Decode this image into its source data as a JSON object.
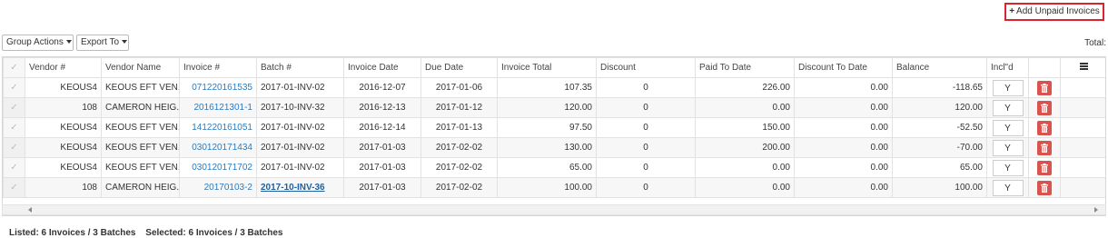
{
  "toolbar": {
    "add_unpaid_label": "Add Unpaid Invoices",
    "group_actions_label": "Group Actions",
    "export_to_label": "Export To",
    "total_label": "Total:"
  },
  "grid": {
    "columns": [
      "Vendor #",
      "Vendor Name",
      "Invoice #",
      "Batch #",
      "Invoice Date",
      "Due Date",
      "Invoice Total",
      "Discount",
      "Paid To Date",
      "Discount To Date",
      "Balance",
      "Incl\"d"
    ],
    "rows": [
      {
        "vendor_no": "KEOUS4",
        "vendor_name": "KEOUS EFT VEN...",
        "invoice_no": "071220161535",
        "batch_no": "2017-01-INV-02",
        "invoice_date": "2016-12-07",
        "due_date": "2017-01-06",
        "invoice_total": "107.35",
        "discount": "0",
        "paid_to_date": "226.00",
        "discount_to_date": "0.00",
        "balance": "-118.65",
        "incl": "Y"
      },
      {
        "vendor_no": "108",
        "vendor_name": "CAMERON HEIG...",
        "invoice_no": "2016121301-1",
        "batch_no": "2017-10-INV-32",
        "invoice_date": "2016-12-13",
        "due_date": "2017-01-12",
        "invoice_total": "120.00",
        "discount": "0",
        "paid_to_date": "0.00",
        "discount_to_date": "0.00",
        "balance": "120.00",
        "incl": "Y"
      },
      {
        "vendor_no": "KEOUS4",
        "vendor_name": "KEOUS EFT VEN...",
        "invoice_no": "141220161051",
        "batch_no": "2017-01-INV-02",
        "invoice_date": "2016-12-14",
        "due_date": "2017-01-13",
        "invoice_total": "97.50",
        "discount": "0",
        "paid_to_date": "150.00",
        "discount_to_date": "0.00",
        "balance": "-52.50",
        "incl": "Y"
      },
      {
        "vendor_no": "KEOUS4",
        "vendor_name": "KEOUS EFT VEN...",
        "invoice_no": "030120171434",
        "batch_no": "2017-01-INV-02",
        "invoice_date": "2017-01-03",
        "due_date": "2017-02-02",
        "invoice_total": "130.00",
        "discount": "0",
        "paid_to_date": "200.00",
        "discount_to_date": "0.00",
        "balance": "-70.00",
        "incl": "Y"
      },
      {
        "vendor_no": "KEOUS4",
        "vendor_name": "KEOUS EFT VEN...",
        "invoice_no": "030120171702",
        "batch_no": "2017-01-INV-02",
        "invoice_date": "2017-01-03",
        "due_date": "2017-02-02",
        "invoice_total": "65.00",
        "discount": "0",
        "paid_to_date": "0.00",
        "discount_to_date": "0.00",
        "balance": "65.00",
        "incl": "Y"
      },
      {
        "vendor_no": "108",
        "vendor_name": "CAMERON HEIG...",
        "invoice_no": "20170103-2",
        "batch_no": "2017-10-INV-36",
        "invoice_date": "2017-01-03",
        "due_date": "2017-02-02",
        "invoice_total": "100.00",
        "discount": "0",
        "paid_to_date": "0.00",
        "discount_to_date": "0.00",
        "balance": "100.00",
        "incl": "Y"
      }
    ]
  },
  "footer": {
    "listed": "Listed: 6 Invoices / 3 Batches",
    "selected": "Selected: 6 Invoices / 3 Batches"
  },
  "colors": {
    "accent_red": "#d9232d",
    "link_blue": "#2a7bbf",
    "delete_red": "#d9534f"
  }
}
